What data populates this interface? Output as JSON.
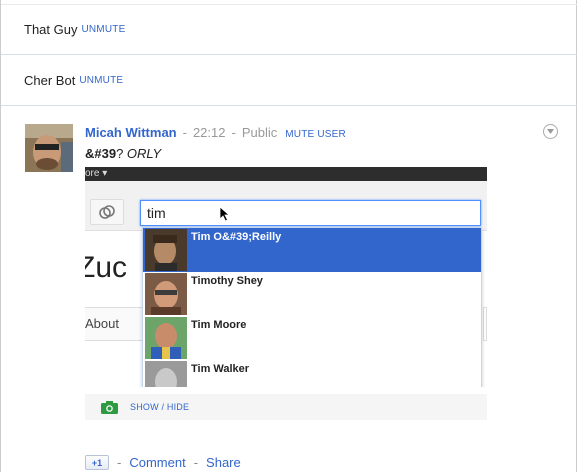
{
  "muted_posts": [
    {
      "name": "That Guy",
      "action": "UNMUTE"
    },
    {
      "name": "Cher Bot",
      "action": "UNMUTE"
    }
  ],
  "post": {
    "author": "Micah Wittman",
    "time": "22:12",
    "visibility": "Public",
    "mute_label": "MUTE USER",
    "text_bold": "&#39",
    "text_plain": "? ",
    "text_italic": "ORLY",
    "menu_icon": "chevron-down-icon"
  },
  "screenshot": {
    "top_bar_text": "ore ▾",
    "search_value": "tim",
    "big_text": "Zuc",
    "tab_label": "About",
    "suggestions": [
      {
        "name": "Tim O&#39;Reilly",
        "selected": true
      },
      {
        "name": "Timothy Shey",
        "selected": false
      },
      {
        "name": "Tim Moore",
        "selected": false
      },
      {
        "name": "Tim Walker",
        "selected": false
      }
    ]
  },
  "media": {
    "label": "SHOW / HIDE",
    "icon": "camera-icon"
  },
  "actions": {
    "plusone_label": "+1",
    "separator": "-",
    "comment_label": "Comment",
    "share_label": "Share"
  },
  "colors": {
    "link": "#3366cc",
    "selected": "#3366cc",
    "meta": "#999999"
  }
}
